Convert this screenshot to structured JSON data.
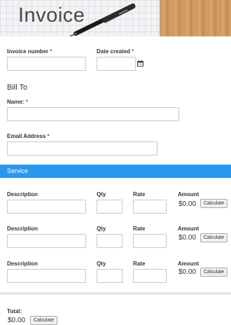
{
  "header": {
    "title": "Invoice"
  },
  "invoice_info": {
    "invoice_number_label": "Invoice number",
    "date_created_label": "Date created",
    "required_mark": "*"
  },
  "bill_to": {
    "heading": "Bill To",
    "name_label": "Name:",
    "email_label": "Email Address"
  },
  "service": {
    "bar_label": "Service",
    "rows": [
      {
        "description_label": "Description",
        "qty_label": "Qty",
        "rate_label": "Rate",
        "amount_label": "Amount",
        "amount_value": "$0.00",
        "calculate_label": "Calculate"
      },
      {
        "description_label": "Description",
        "qty_label": "Qty",
        "rate_label": "Rate",
        "amount_label": "Amount",
        "amount_value": "$0.00",
        "calculate_label": "Calculate"
      },
      {
        "description_label": "Description",
        "qty_label": "Qty",
        "rate_label": "Rate",
        "amount_label": "Amount",
        "amount_value": "$0.00",
        "calculate_label": "Calculate"
      }
    ]
  },
  "total": {
    "label": "Total:",
    "value": "$0.00",
    "calculate_label": "Calculate"
  },
  "colors": {
    "accent": "#2b97ec",
    "required": "#e0352b"
  },
  "icons": {
    "date_picker": "calendar-icon"
  }
}
